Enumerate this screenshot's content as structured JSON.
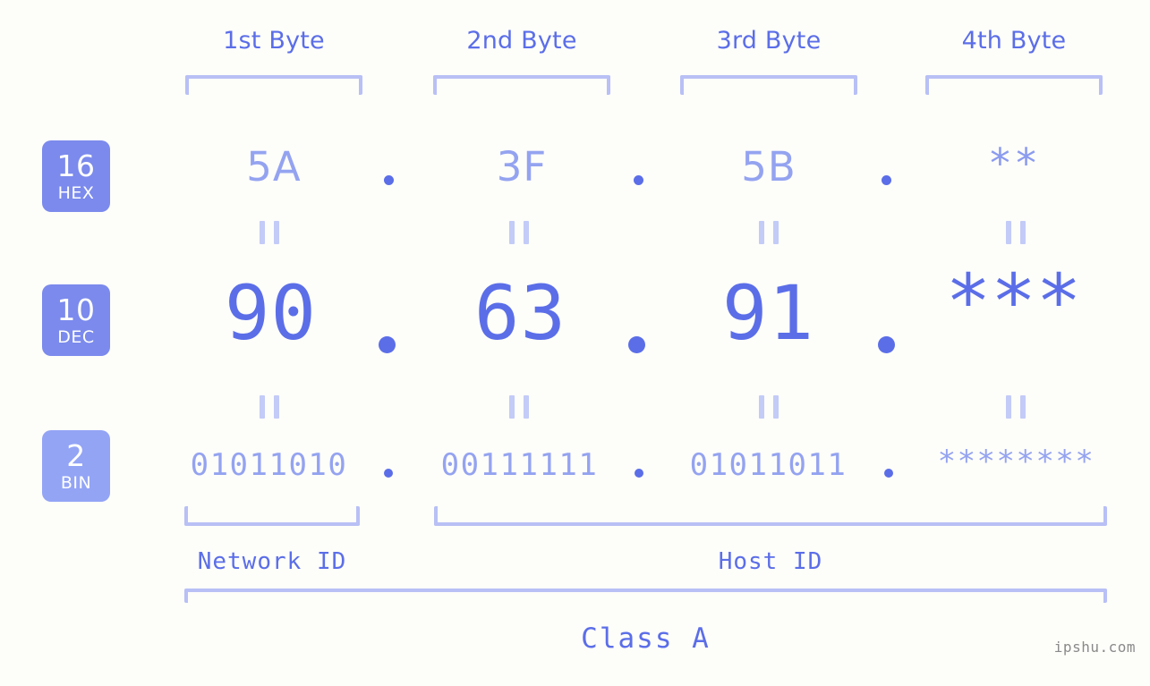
{
  "headers": [
    {
      "label": "1st Byte"
    },
    {
      "label": "2nd Byte"
    },
    {
      "label": "3rd Byte"
    },
    {
      "label": "4th Byte"
    }
  ],
  "bases": [
    {
      "number": "16",
      "name": "HEX",
      "color": "#7b8aec"
    },
    {
      "number": "10",
      "name": "DEC",
      "color": "#7b8aec"
    },
    {
      "number": "2",
      "name": "BIN",
      "color": "#93a4f5"
    }
  ],
  "rows": {
    "hex": {
      "values": [
        "5A",
        "3F",
        "5B",
        "**"
      ]
    },
    "dec": {
      "values": [
        "90",
        "63",
        "91",
        "***"
      ]
    },
    "bin": {
      "values": [
        "01011010",
        "00111111",
        "01011011",
        "********"
      ]
    }
  },
  "separator": ".",
  "equals_glyph": "||",
  "sections": [
    {
      "label": "Network ID"
    },
    {
      "label": "Host ID"
    }
  ],
  "class": {
    "label": "Class A"
  },
  "watermark": {
    "text": "ipshu.com"
  },
  "colors": {
    "background": "#fdfdfa",
    "accent_strong": "#5b6ee8",
    "accent_light": "#94a3f0",
    "bracket": "#b8c0f5",
    "badge_fill": "#7b8aec",
    "badge_fill_light": "#93a4f5",
    "watermark": "#8a8a8a"
  }
}
